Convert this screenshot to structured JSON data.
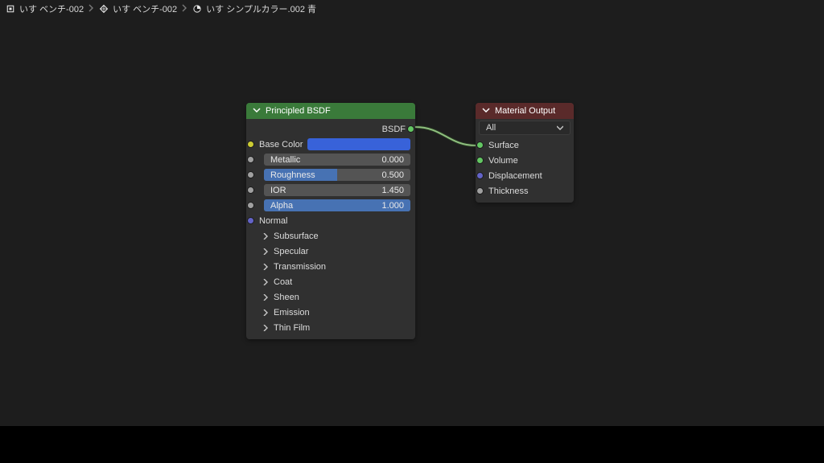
{
  "breadcrumb": {
    "item1": "いす ベンチ-002",
    "item2": "いす ベンチ-002",
    "item3": "いす シンプルカラー.002 青"
  },
  "node_bsdf": {
    "title": "Principled BSDF",
    "out_bsdf": "BSDF",
    "base_color_label": "Base Color",
    "base_color_value": "#3862d9",
    "metallic_label": "Metallic",
    "metallic_value": "0.000",
    "metallic_fill": 0,
    "roughness_label": "Roughness",
    "roughness_value": "0.500",
    "roughness_fill": 0.5,
    "ior_label": "IOR",
    "ior_value": "1.450",
    "ior_fill": 0,
    "alpha_label": "Alpha",
    "alpha_value": "1.000",
    "alpha_fill": 1.0,
    "normal_label": "Normal",
    "exp_subsurface": "Subsurface",
    "exp_specular": "Specular",
    "exp_transmission": "Transmission",
    "exp_coat": "Coat",
    "exp_sheen": "Sheen",
    "exp_emission": "Emission",
    "exp_thinfilm": "Thin Film"
  },
  "node_output": {
    "title": "Material Output",
    "target": "All",
    "in_surface": "Surface",
    "in_volume": "Volume",
    "in_displacement": "Displacement",
    "in_thickness": "Thickness"
  },
  "colors": {
    "noodle": "#7aa66e"
  },
  "chart_data": {
    "type": "node-graph",
    "nodes": [
      {
        "id": "principled_bsdf",
        "title": "Principled BSDF",
        "outputs": [
          "BSDF"
        ],
        "inputs": [
          "Base Color",
          "Metallic",
          "Roughness",
          "IOR",
          "Alpha",
          "Normal",
          "Subsurface",
          "Specular",
          "Transmission",
          "Coat",
          "Sheen",
          "Emission",
          "Thin Film"
        ],
        "values": {
          "Base Color": "#3862d9",
          "Metallic": 0.0,
          "Roughness": 0.5,
          "IOR": 1.45,
          "Alpha": 1.0
        }
      },
      {
        "id": "material_output",
        "title": "Material Output",
        "target": "All",
        "inputs": [
          "Surface",
          "Volume",
          "Displacement",
          "Thickness"
        ]
      }
    ],
    "links": [
      {
        "from": "principled_bsdf.BSDF",
        "to": "material_output.Surface"
      }
    ]
  }
}
